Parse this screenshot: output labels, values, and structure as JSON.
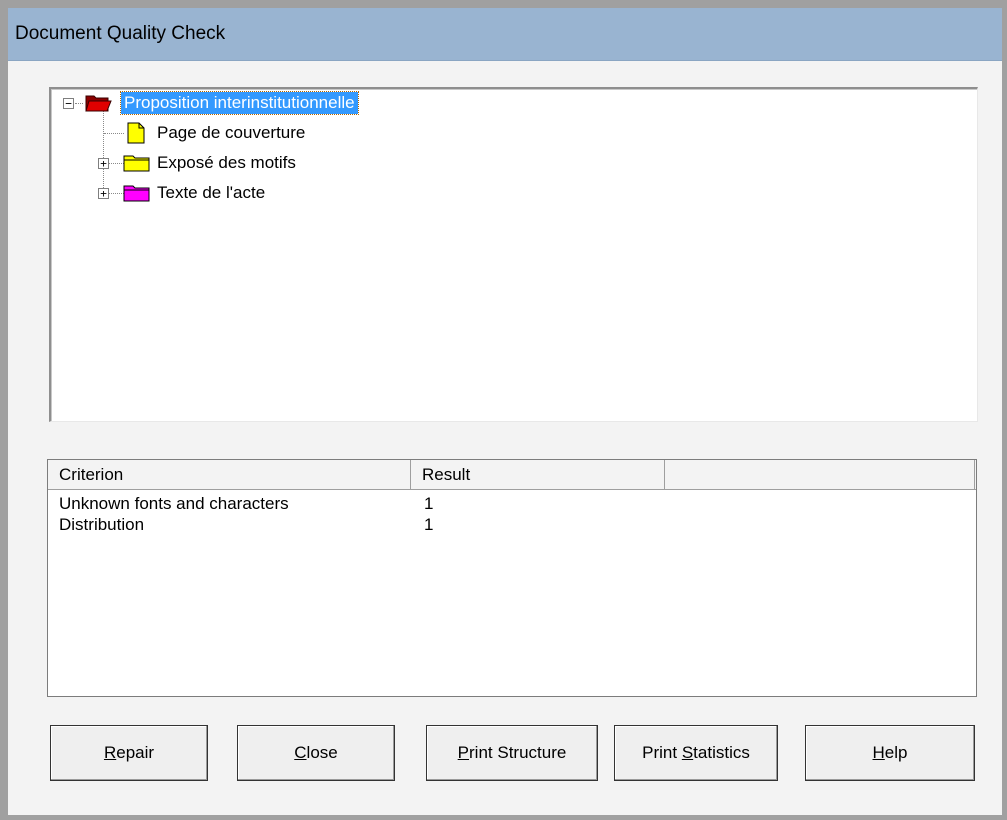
{
  "window": {
    "title": "Document Quality Check"
  },
  "tree": {
    "root": {
      "label": "Proposition interinstitutionnelle",
      "icon": "red-folder-open-icon",
      "expanded": true,
      "selected": true
    },
    "children": [
      {
        "label": "Page de couverture",
        "icon": "yellow-document-icon",
        "expandable": false
      },
      {
        "label": "Exposé des motifs",
        "icon": "yellow-folder-icon",
        "expandable": true
      },
      {
        "label": "Texte de l'acte",
        "icon": "magenta-folder-icon",
        "expandable": true
      }
    ]
  },
  "results": {
    "columns": [
      "Criterion",
      "Result",
      ""
    ],
    "rows": [
      {
        "criterion": "Unknown fonts and characters",
        "result": "1"
      },
      {
        "criterion": "Distribution",
        "result": "1"
      }
    ]
  },
  "buttons": {
    "repair": {
      "mnemonic": "R",
      "rest": "epair"
    },
    "close": {
      "mnemonic": "C",
      "rest": "lose"
    },
    "print_structure": {
      "mnemonic": "P",
      "rest": "rint Structure"
    },
    "print_statistics": {
      "before": "Print ",
      "mnemonic": "S",
      "rest": "tatistics"
    },
    "help": {
      "mnemonic": "H",
      "rest": "elp"
    }
  },
  "colors": {
    "titlebar": "#99b4d1",
    "selection": "#3399ff",
    "folder_yellow": "#ffff00",
    "folder_magenta": "#ff00ff",
    "folder_red": "#cc0000"
  }
}
